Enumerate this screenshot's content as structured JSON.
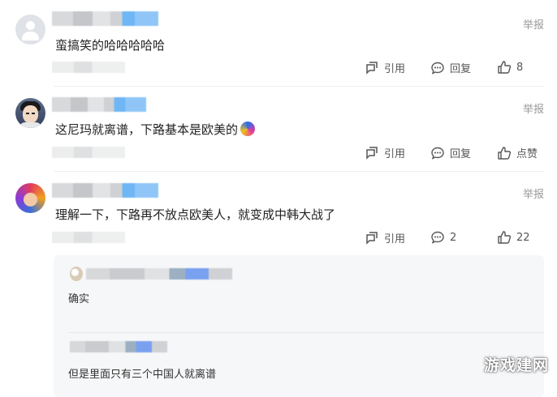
{
  "comments": [
    {
      "text": "蛮搞笑的哈哈哈哈哈",
      "report": "举报",
      "actions": {
        "quote": "引用",
        "reply": "回复",
        "like": "8"
      }
    },
    {
      "text": "这尼玛就离谱，下路基本是欧美的",
      "report": "举报",
      "actions": {
        "quote": "引用",
        "reply": "回复",
        "like": "点赞"
      }
    },
    {
      "text": "理解一下，下路再不放点欧美人，就变成中韩大战了",
      "report": "举报",
      "actions": {
        "quote": "引用",
        "reply": "2",
        "like": "22"
      }
    }
  ],
  "replies": [
    {
      "text": "确实"
    },
    {
      "text": "但是里面只有三个中国人就离谱"
    }
  ],
  "watermark": "游戏建网",
  "icons": [
    "quote-icon",
    "reply-bubble-icon",
    "thumbs-up-icon"
  ],
  "colors": {
    "action_text": "#555555",
    "report_text": "#999999",
    "divider": "#eceef1",
    "reply_bg": "#f6f7f8"
  }
}
